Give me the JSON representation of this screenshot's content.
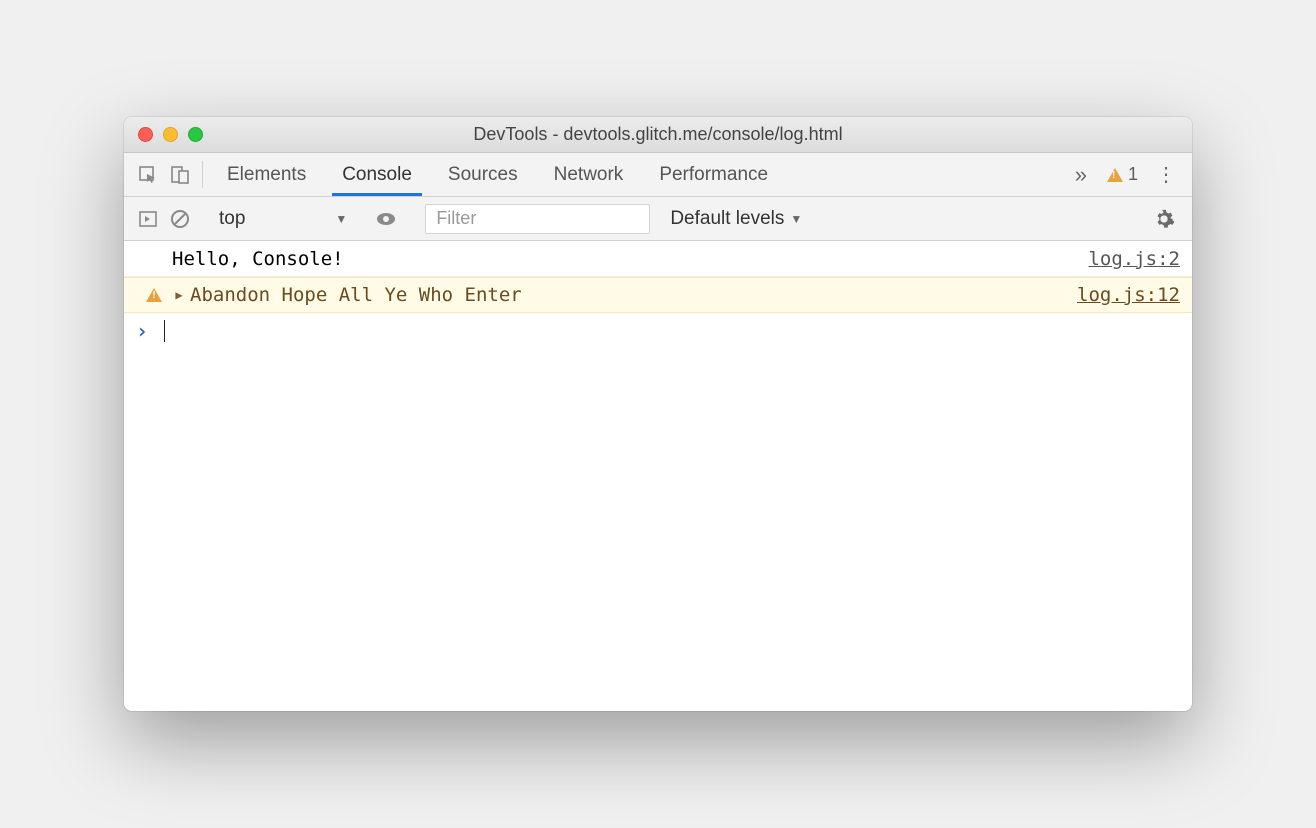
{
  "window": {
    "title": "DevTools - devtools.glitch.me/console/log.html"
  },
  "tabs": {
    "elements": "Elements",
    "console": "Console",
    "sources": "Sources",
    "network": "Network",
    "performance": "Performance",
    "active": "console"
  },
  "warnings": {
    "count": "1"
  },
  "toolbar": {
    "context": "top",
    "filter_placeholder": "Filter",
    "levels": "Default levels"
  },
  "logs": [
    {
      "type": "log",
      "message": "Hello, Console!",
      "source": "log.js:2"
    },
    {
      "type": "warning",
      "message": "Abandon Hope All Ye Who Enter",
      "source": "log.js:12"
    }
  ],
  "prompt": {
    "marker": "›"
  }
}
